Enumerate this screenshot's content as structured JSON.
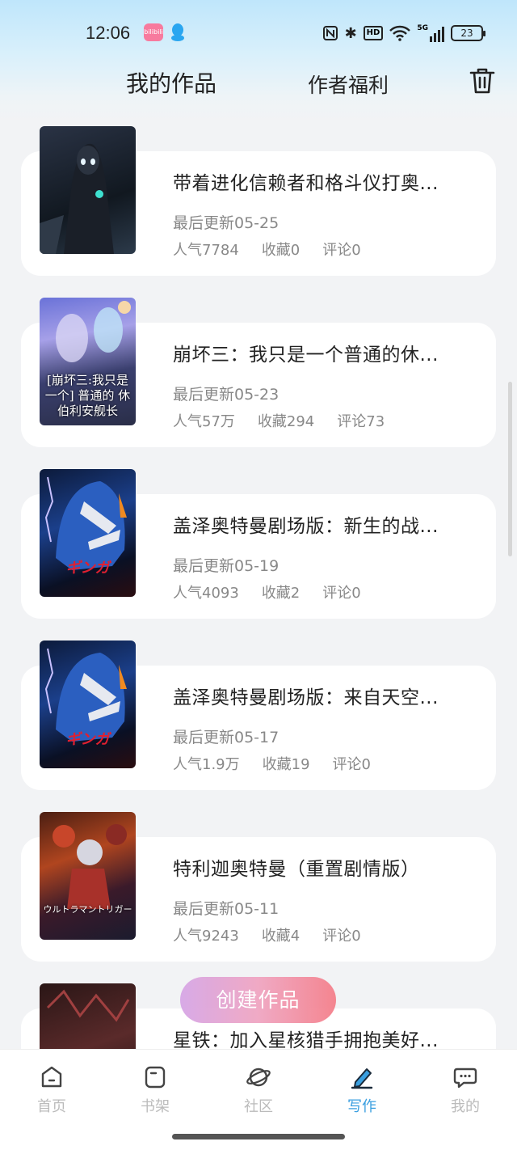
{
  "status_bar": {
    "time": "12:06",
    "bili_label": "bilibili",
    "network": "5G",
    "battery": "23",
    "hd": "HD"
  },
  "header": {
    "tab_works": "我的作品",
    "tab_welfare": "作者福利"
  },
  "works": [
    {
      "title": "带着进化信赖者和格斗仪打奥...",
      "updated": "最后更新05-25",
      "popularity": "人气7784",
      "favorites": "收藏0",
      "comments": "评论0"
    },
    {
      "title": "崩坏三：我只是一个普通的休...",
      "updated": "最后更新05-23",
      "popularity": "人气57万",
      "favorites": "收藏294",
      "comments": "评论73",
      "cover_text": "[崩坏三:我只是一个] 普通的 休伯利安舰长"
    },
    {
      "title": "盖泽奥特曼剧场版：新生的战...",
      "updated": "最后更新05-19",
      "popularity": "人气4093",
      "favorites": "收藏2",
      "comments": "评论0",
      "cover_text": "ギンガ"
    },
    {
      "title": "盖泽奥特曼剧场版：来自天空...",
      "updated": "最后更新05-17",
      "popularity": "人气1.9万",
      "favorites": "收藏19",
      "comments": "评论0",
      "cover_text": "ギンガ"
    },
    {
      "title": "特利迦奥特曼（重置剧情版）",
      "updated": "最后更新05-11",
      "popularity": "人气9243",
      "favorites": "收藏4",
      "comments": "评论0",
      "cover_text": "ウルトラマントリガー"
    },
    {
      "title": "星铁：加入星核猎手拥抱美好..."
    }
  ],
  "create_button": "创建作品",
  "nav": [
    {
      "label": "首页",
      "icon": "home-icon"
    },
    {
      "label": "书架",
      "icon": "bookshelf-icon"
    },
    {
      "label": "社区",
      "icon": "planet-icon"
    },
    {
      "label": "写作",
      "icon": "pen-icon",
      "active": true
    },
    {
      "label": "我的",
      "icon": "chat-bubble-icon"
    }
  ],
  "colors": {
    "accent": "#3a9fe0",
    "create_gradient_start": "#d6a6e6",
    "create_gradient_end": "#f47f8a",
    "background": "#f2f3f5"
  }
}
